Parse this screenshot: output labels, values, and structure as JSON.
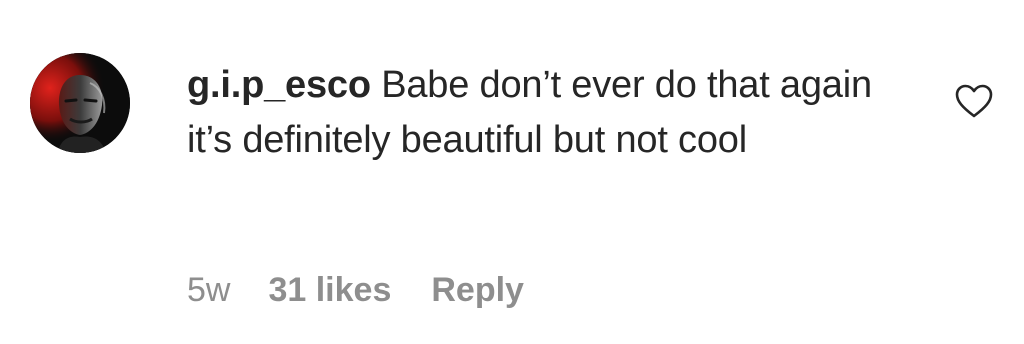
{
  "comment": {
    "username": "g.i.p_esco",
    "text": "Babe don’t ever do that again it’s definitely beautiful but not cool",
    "time": "5w",
    "likes": "31 likes",
    "reply_label": "Reply"
  },
  "icons": {
    "like": "heart-outline-icon",
    "avatar": "profile-photo"
  },
  "colors": {
    "text": "#262626",
    "meta": "#8e8e8e",
    "background": "#ffffff"
  }
}
